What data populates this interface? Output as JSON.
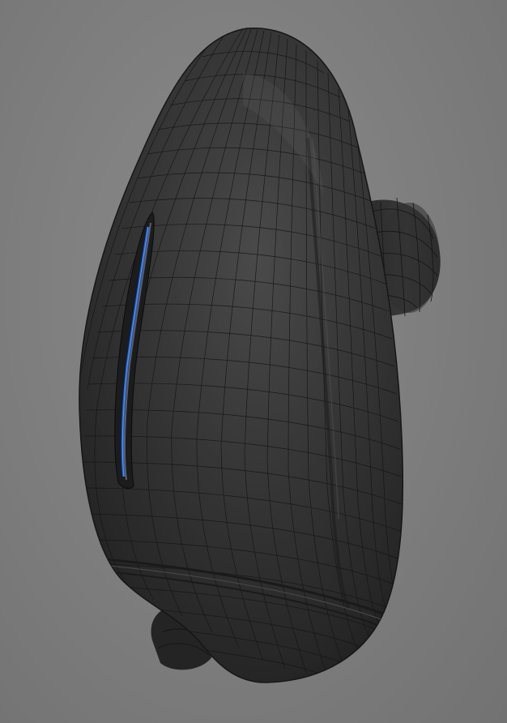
{
  "viewport": {
    "background_color": "#7b7b7b"
  },
  "model": {
    "body_color": "#2f2f2f",
    "wire_color": "#141414",
    "accent_color": "#1f63d8"
  }
}
